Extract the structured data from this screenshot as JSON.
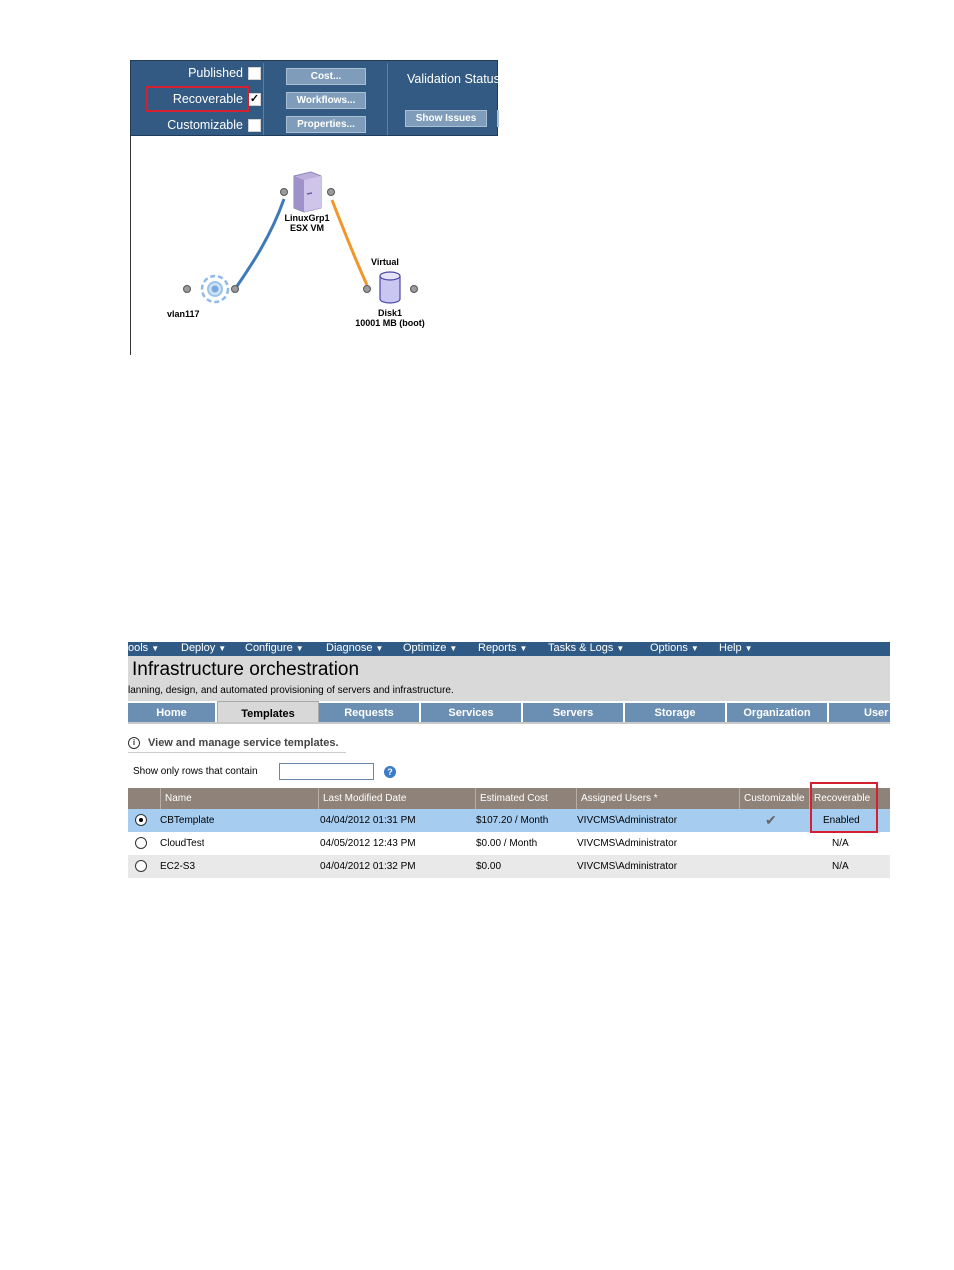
{
  "template_editor": {
    "checkboxes": [
      {
        "label": "Published",
        "checked": false
      },
      {
        "label": "Recoverable",
        "checked": true
      },
      {
        "label": "Customizable",
        "checked": false
      }
    ],
    "buttons": {
      "cost": "Cost...",
      "workflows": "Workflows...",
      "properties": "Properties..."
    },
    "validation_label": "Validation Status",
    "show_issues": "Show Issues",
    "diagram": {
      "server_label_1": "LinuxGrp1",
      "server_label_2": "ESX VM",
      "network_label": "vlan117",
      "disk_top_label": "Virtual",
      "disk_label_1": "Disk1",
      "disk_label_2": "10001 MB (boot)",
      "colors": {
        "network_link": "#3f7ab8",
        "storage_link": "#f2962a"
      }
    }
  },
  "orchestration": {
    "menu": [
      "ools",
      "Deploy",
      "Configure",
      "Diagnose",
      "Optimize",
      "Reports",
      "Tasks & Logs",
      "Options",
      "Help"
    ],
    "title": "Infrastructure orchestration",
    "subtitle": "lanning, design, and automated provisioning of servers and infrastructure.",
    "tabs": [
      "Home",
      "Templates",
      "Requests",
      "Services",
      "Servers",
      "Storage",
      "Organization",
      "User"
    ],
    "active_tab": "Templates",
    "info_text": "View and manage service templates.",
    "filter_label": "Show only rows that contain",
    "filter_value": "",
    "columns": [
      "Name",
      "Last Modified Date",
      "Estimated Cost",
      "Assigned Users *",
      "Customizable",
      "Recoverable"
    ],
    "rows": [
      {
        "name": "CBTemplate",
        "modified": "04/04/2012 01:31 PM",
        "cost": "$107.20 / Month",
        "users": "VIVCMS\\Administrator",
        "customizable": true,
        "recoverable": "Enabled",
        "selected": true
      },
      {
        "name": "CloudTest",
        "modified": "04/05/2012 12:43 PM",
        "cost": "$0.00 / Month",
        "users": "VIVCMS\\Administrator",
        "customizable": false,
        "recoverable": "N/A",
        "selected": false
      },
      {
        "name": "EC2-S3",
        "modified": "04/04/2012 01:32 PM",
        "cost": "$0.00",
        "users": "VIVCMS\\Administrator",
        "customizable": false,
        "recoverable": "N/A",
        "selected": false
      }
    ],
    "colors": {
      "menu_bg": "#2f5a85",
      "tab_bg": "#6b8fb3",
      "header_bg": "#8e8279",
      "selected_row": "#a6cdf0",
      "highlight": "#d42030"
    }
  }
}
